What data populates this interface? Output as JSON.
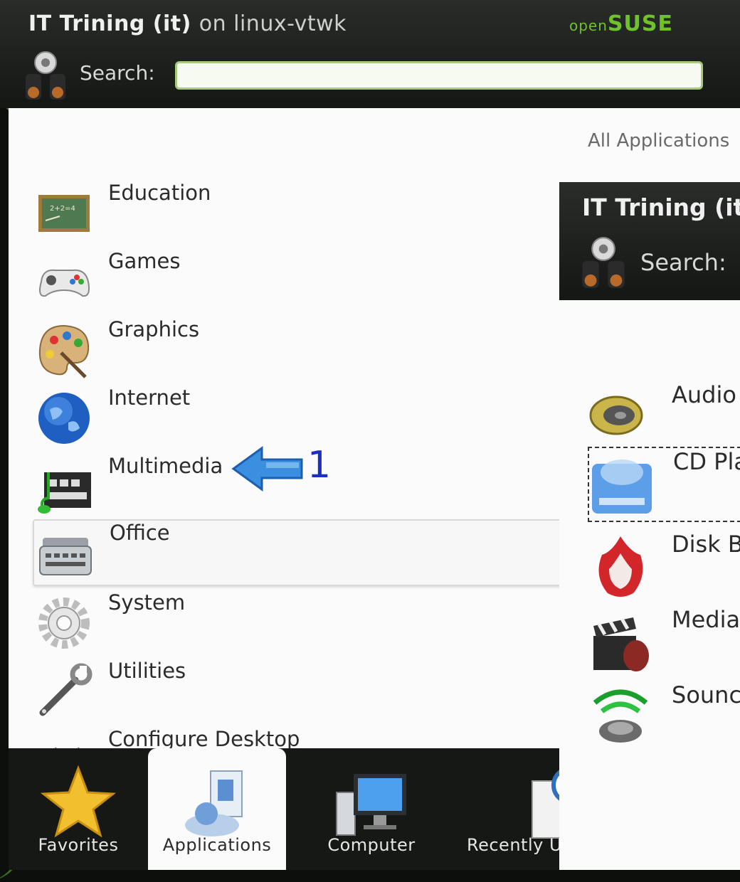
{
  "menu": {
    "user_name": "IT Trining (it)",
    "user_host": "on linux-vtwk",
    "brand_open": "open",
    "brand_suse": "SUSE",
    "search_label": "Search:",
    "search_value": "",
    "breadcrumb": "All Applications",
    "categories": [
      {
        "label": "Education",
        "icon": "education-icon"
      },
      {
        "label": "Games",
        "icon": "gamepad-icon"
      },
      {
        "label": "Graphics",
        "icon": "palette-icon"
      },
      {
        "label": "Internet",
        "icon": "globe-icon"
      },
      {
        "label": "Multimedia",
        "icon": "multimedia-icon"
      },
      {
        "label": "Office",
        "icon": "typewriter-icon"
      },
      {
        "label": "System",
        "icon": "gear-icon"
      },
      {
        "label": "Utilities",
        "icon": "wrench-icon"
      },
      {
        "label": "Configure Desktop",
        "icon": "configure-icon"
      }
    ],
    "selected_category": "Office",
    "annotation_number": "1",
    "tabs": [
      {
        "label": "Favorites",
        "icon": "star-icon"
      },
      {
        "label": "Applications",
        "icon": "applications-icon"
      },
      {
        "label": "Computer",
        "icon": "computer-icon"
      },
      {
        "label": "Recently U",
        "icon": "recent-documents-icon"
      }
    ],
    "active_tab": "Applications"
  },
  "submenu": {
    "user_name": "IT Trining (it",
    "search_label": "Search:",
    "items": [
      {
        "label": "Audio",
        "icon": "speaker-icon"
      },
      {
        "label": "CD Pla",
        "icon": "cd-player-icon"
      },
      {
        "label": "Disk B",
        "icon": "disk-burner-icon"
      },
      {
        "label": "Media",
        "icon": "clapperboard-icon"
      },
      {
        "label": "Sounc",
        "icon": "sound-icon"
      }
    ]
  },
  "colors": {
    "header_bg": "#1f211f",
    "brand_green": "#6fc22a",
    "annotation_blue": "#1c2fc4",
    "arrow_blue": "#3b8fe0"
  }
}
